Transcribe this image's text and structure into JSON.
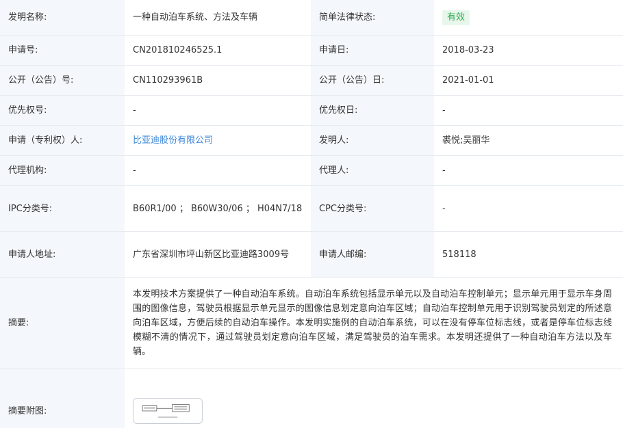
{
  "fields": {
    "invention_name": {
      "label": "发明名称:",
      "value": "一种自动泊车系统、方法及车辆"
    },
    "legal_status": {
      "label": "简单法律状态:",
      "value": "有效"
    },
    "application_number": {
      "label": "申请号:",
      "value": "CN201810246525.1"
    },
    "application_date": {
      "label": "申请日:",
      "value": "2018-03-23"
    },
    "publication_number": {
      "label": "公开（公告）号:",
      "value": "CN110293961B"
    },
    "publication_date": {
      "label": "公开（公告）日:",
      "value": "2021-01-01"
    },
    "priority_number": {
      "label": "优先权号:",
      "value": "-"
    },
    "priority_date": {
      "label": "优先权日:",
      "value": "-"
    },
    "applicant": {
      "label": "申请（专利权）人:",
      "value": "比亚迪股份有限公司"
    },
    "inventor": {
      "label": "发明人:",
      "value": "裘悦;吴丽华"
    },
    "agency": {
      "label": "代理机构:",
      "value": "-"
    },
    "agent": {
      "label": "代理人:",
      "value": "-"
    },
    "ipc": {
      "label": "IPC分类号:",
      "value": "B60R1/00 ； B60W30/06 ； H04N7/18"
    },
    "cpc": {
      "label": "CPC分类号:",
      "value": "-"
    },
    "applicant_address": {
      "label": "申请人地址:",
      "value": "广东省深圳市坪山新区比亚迪路3009号"
    },
    "applicant_postcode": {
      "label": "申请人邮编:",
      "value": "518118"
    },
    "abstract": {
      "label": "摘要:",
      "value": "本发明技术方案提供了一种自动泊车系统。自动泊车系统包括显示单元以及自动泊车控制单元；显示单元用于显示车身周围的图像信息，驾驶员根据显示单元显示的图像信息划定意向泊车区域；自动泊车控制单元用于识别驾驶员划定的所述意向泊车区域，方便后续的自动泊车操作。本发明实施例的自动泊车系统，可以在没有停车位标志线，或者是停车位标志线模糊不清的情况下，通过驾驶员划定意向泊车区域，满足驾驶员的泊车需求。本发明还提供了一种自动泊车方法以及车辆。"
    },
    "abstract_figure": {
      "label": "摘要附图:"
    }
  },
  "colors": {
    "label_bg": "#f4f7fb",
    "border": "#e6ebf0",
    "link": "#3a86d9",
    "status_green": "#2eaa4f",
    "status_bg": "#e8f7ec"
  }
}
